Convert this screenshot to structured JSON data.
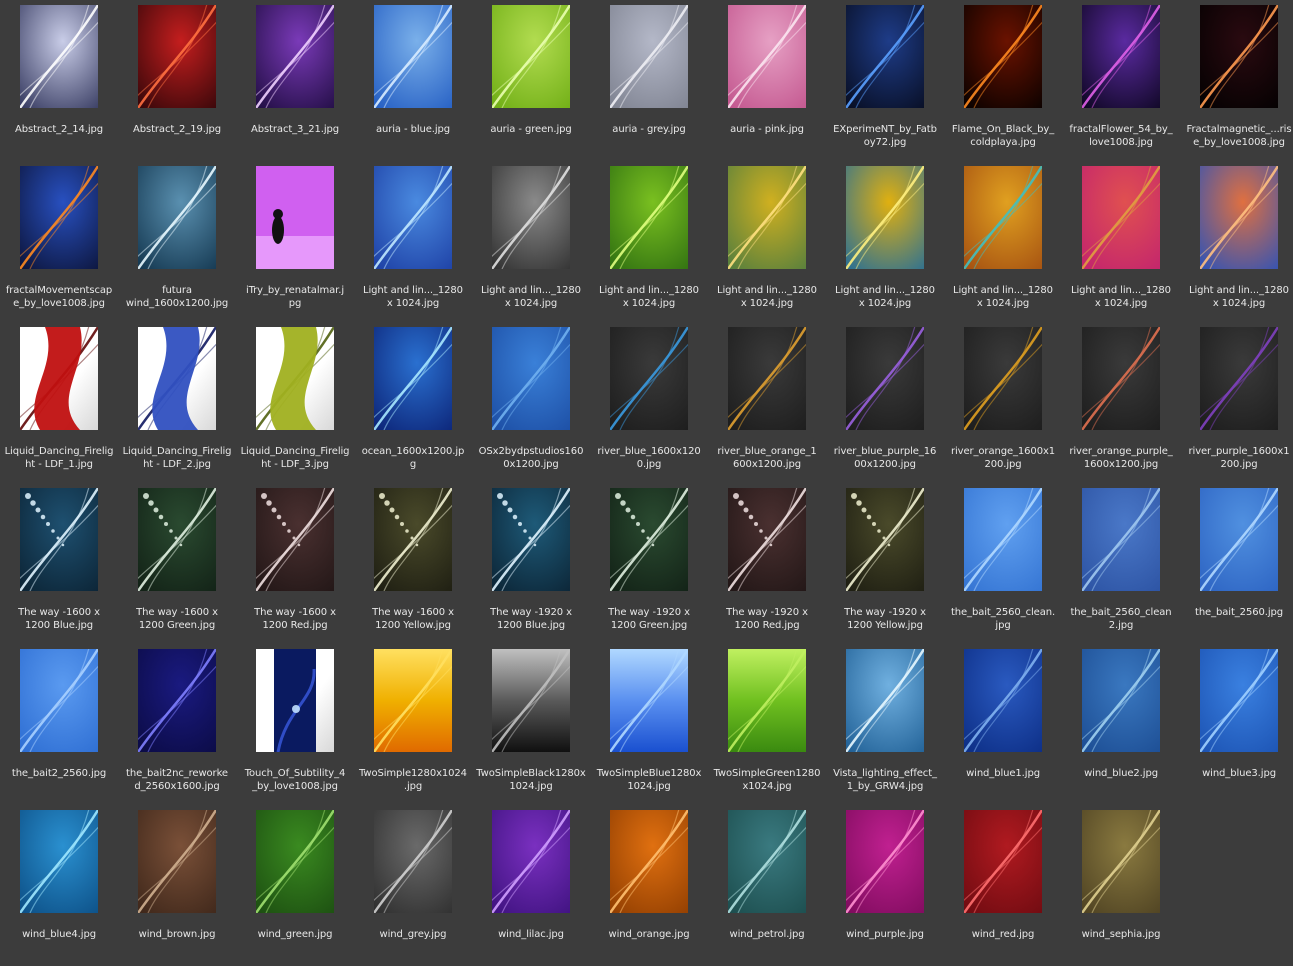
{
  "files": [
    {
      "label": "Abstract_2_14.jpg",
      "icon": "abstract-light-thumbnail",
      "colors": [
        "#2a2e55",
        "#c9cde8",
        "#ffffff"
      ]
    },
    {
      "label": "Abstract_2_19.jpg",
      "icon": "abstract-red-thumbnail",
      "colors": [
        "#2a0508",
        "#c41e1e",
        "#ff7040"
      ]
    },
    {
      "label": "Abstract_3_21.jpg",
      "icon": "abstract-purple-thumbnail",
      "colors": [
        "#1a0a3a",
        "#7a3ab8",
        "#f0d0ff"
      ]
    },
    {
      "label": "auria - blue.jpg",
      "icon": "auria-blue-thumbnail",
      "colors": [
        "#1e58c0",
        "#7ab0ea",
        "#d8ecff"
      ]
    },
    {
      "label": "auria - green.jpg",
      "icon": "auria-green-thumbnail",
      "colors": [
        "#6aaa10",
        "#b2dc50",
        "#eaffb0"
      ]
    },
    {
      "label": "auria - grey.jpg",
      "icon": "auria-grey-thumbnail",
      "colors": [
        "#7a7e8c",
        "#b4b8c8",
        "#eeeef4"
      ]
    },
    {
      "label": "auria - pink.jpg",
      "icon": "auria-pink-thumbnail",
      "colors": [
        "#c0508a",
        "#e6a0c4",
        "#fbe4f0"
      ]
    },
    {
      "label": "EXperimeNT_by_Fatb\noy72.jpg",
      "icon": "experiment-thumbnail",
      "colors": [
        "#060a1a",
        "#1e3c88",
        "#5aa0ff"
      ]
    },
    {
      "label": "Flame_On_Black_by_\ncoldplaya.jpg",
      "icon": "flame-thumbnail",
      "colors": [
        "#000000",
        "#6a1200",
        "#ff8a20"
      ]
    },
    {
      "label": "fractalFlower_54_by_\nlove1008.jpg",
      "icon": "fractal-flower-thumbnail",
      "colors": [
        "#080418",
        "#5a2aa0",
        "#e060e8"
      ]
    },
    {
      "label": "Fractalmagnetic_...ris\ne_by_love1008.jpg",
      "icon": "fractal-magnetic-thumbnail",
      "colors": [
        "#000000",
        "#2a0a10",
        "#ff9a50"
      ]
    },
    {
      "label": "fractalMovementscap\ne_by_love1008.jpg",
      "icon": "fractal-movement-thumbnail",
      "colors": [
        "#0a1030",
        "#2850c0",
        "#ff8a20"
      ]
    },
    {
      "label": "futura\nwind_1600x1200.jpg",
      "icon": "futura-wind-thumbnail",
      "colors": [
        "#0e3048",
        "#5a90b0",
        "#e8f8ff"
      ]
    },
    {
      "label": "iTry_by_renatalmar.j\npg",
      "icon": "itry-thumbnail",
      "colors": [
        "#8a1ec0",
        "#d060f0",
        "#f0b0ff"
      ]
    },
    {
      "label": "Light and lin..._1280\nx 1024.jpg",
      "icon": "light-lines-blue-thumbnail",
      "colors": [
        "#1a3aa0",
        "#4a8ae0",
        "#c0e8ff"
      ]
    },
    {
      "label": "Light and lin..._1280\nx 1024.jpg",
      "icon": "light-lines-grey-thumbnail",
      "colors": [
        "#2a2a2a",
        "#8a8a8a",
        "#e0e0e0"
      ]
    },
    {
      "label": "Light and lin..._1280\nx 1024.jpg",
      "icon": "light-lines-green-thumbnail",
      "colors": [
        "#2a6a10",
        "#7ac020",
        "#e0ff80"
      ]
    },
    {
      "label": "Light and lin..._1280\nx 1024.jpg",
      "icon": "light-lines-yellow-thumbnail",
      "colors": [
        "#4a7a40",
        "#d0b020",
        "#ffe080"
      ]
    },
    {
      "label": "Light and lin..._1280\nx 1024.jpg",
      "icon": "light-lines-gold-thumbnail",
      "colors": [
        "#1a6aa0",
        "#e0b010",
        "#fff080"
      ]
    },
    {
      "label": "Light and lin..._1280\nx 1024.jpg",
      "icon": "light-lines-teal-thumbnail",
      "colors": [
        "#a04a10",
        "#e0a020",
        "#40c0c0"
      ]
    },
    {
      "label": "Light and lin..._1280\nx 1024.jpg",
      "icon": "light-lines-magenta-thumbnail",
      "colors": [
        "#c02070",
        "#e05050",
        "#e0a040"
      ]
    },
    {
      "label": "Light and lin..._1280\nx 1024.jpg",
      "icon": "light-lines-sunset-thumbnail",
      "colors": [
        "#2050c0",
        "#e07040",
        "#ffc080"
      ]
    },
    {
      "label": "Liquid_Dancing_Firelig\nht - LDF_1.jpg",
      "icon": "liquid-red-thumbnail",
      "colors": [
        "#ffffff",
        "#c01010",
        "#600808"
      ]
    },
    {
      "label": "Liquid_Dancing_Firelig\nht - LDF_2.jpg",
      "icon": "liquid-blue-thumbnail",
      "colors": [
        "#ffffff",
        "#3050c0",
        "#101860"
      ]
    },
    {
      "label": "Liquid_Dancing_Firelig\nht - LDF_3.jpg",
      "icon": "liquid-green-thumbnail",
      "colors": [
        "#ffffff",
        "#a0b020",
        "#506010"
      ]
    },
    {
      "label": "ocean_1600x1200.jp\ng",
      "icon": "ocean-thumbnail",
      "colors": [
        "#0a1e70",
        "#2a70d0",
        "#a8e8ff"
      ]
    },
    {
      "label": "OSx2bydpstudios160\n0x1200.jpg",
      "icon": "osx-thumbnail",
      "colors": [
        "#1a4aa0",
        "#3a80d8",
        "#70b0f0"
      ]
    },
    {
      "label": "river_blue_1600x120\n0.jpg",
      "icon": "river-blue-thumbnail",
      "colors": [
        "#1a1a1a",
        "#3a3a3a",
        "#3a9ae0"
      ]
    },
    {
      "label": "river_blue_orange_1\n600x1200.jpg",
      "icon": "river-blue-orange-thumbnail",
      "colors": [
        "#1a1a1a",
        "#3a3a3a",
        "#e0a030"
      ]
    },
    {
      "label": "river_blue_purple_16\n00x1200.jpg",
      "icon": "river-blue-purple-thumbnail",
      "colors": [
        "#1a1a1a",
        "#3a3a3a",
        "#9a60e0"
      ]
    },
    {
      "label": "river_orange_1600x1\n200.jpg",
      "icon": "river-orange-thumbnail",
      "colors": [
        "#1a1a1a",
        "#3a3a3a",
        "#e0a020"
      ]
    },
    {
      "label": "river_orange_purple_\n1600x1200.jpg",
      "icon": "river-orange-purple-thumbnail",
      "colors": [
        "#1a1a1a",
        "#3a3a3a",
        "#e07050"
      ]
    },
    {
      "label": "river_purple_1600x1\n200.jpg",
      "icon": "river-purple-thumbnail",
      "colors": [
        "#1a1a1a",
        "#3a3a3a",
        "#8040c0"
      ]
    },
    {
      "label": "The way -1600 x\n1200 Blue.jpg",
      "icon": "the-way-blue-thumbnail",
      "colors": [
        "#0a2030",
        "#1e5070",
        "#e0f4ff"
      ]
    },
    {
      "label": "The way -1600 x\n1200 Green.jpg",
      "icon": "the-way-green-thumbnail",
      "colors": [
        "#101e14",
        "#2a4a30",
        "#e0f0e0"
      ]
    },
    {
      "label": "The way -1600 x\n1200 Red.jpg",
      "icon": "the-way-red-thumbnail",
      "colors": [
        "#1e1414",
        "#4a3030",
        "#f0e0e0"
      ]
    },
    {
      "label": "The way -1600 x\n1200 Yellow.jpg",
      "icon": "the-way-yellow-thumbnail",
      "colors": [
        "#1a1a10",
        "#4a4a2a",
        "#f0f0d0"
      ]
    },
    {
      "label": "The way -1920 x\n1200 Blue.jpg",
      "icon": "the-way-1920-blue-thumbnail",
      "colors": [
        "#0a2030",
        "#1e5a78",
        "#e0f4ff"
      ]
    },
    {
      "label": "The way -1920 x\n1200 Green.jpg",
      "icon": "the-way-1920-green-thumbnail",
      "colors": [
        "#101e14",
        "#2a4a30",
        "#e0f0e0"
      ]
    },
    {
      "label": "The way -1920 x\n1200 Red.jpg",
      "icon": "the-way-1920-red-thumbnail",
      "colors": [
        "#1e1414",
        "#4a3030",
        "#f0e0e0"
      ]
    },
    {
      "label": "The way -1920 x\n1200 Yellow.jpg",
      "icon": "the-way-1920-yellow-thumbnail",
      "colors": [
        "#1a1a10",
        "#4a4a2a",
        "#f0f0d0"
      ]
    },
    {
      "label": "the_bait_2560_clean.\njpg",
      "icon": "bait-clean-thumbnail",
      "colors": [
        "#3070d0",
        "#60a0f0",
        "#b0d8ff"
      ]
    },
    {
      "label": "the_bait_2560_clean\n2.jpg",
      "icon": "bait-clean2-thumbnail",
      "colors": [
        "#2a50a0",
        "#4a78c8",
        "#a0c8f0"
      ]
    },
    {
      "label": "the_bait_2560.jpg",
      "icon": "bait-thumbnail",
      "colors": [
        "#2a60c0",
        "#5090e0",
        "#b0d8ff"
      ]
    },
    {
      "label": "the_bait2_2560.jpg",
      "icon": "bait2-thumbnail",
      "colors": [
        "#2a6ad0",
        "#5a9af0",
        "#a8d0ff"
      ]
    },
    {
      "label": "the_bait2nc_reworke\nd_2560x1600.jpg",
      "icon": "bait2nc-thumbnail",
      "colors": [
        "#0a0a40",
        "#1a1a80",
        "#8080ff"
      ]
    },
    {
      "label": "Touch_Of_Subtility_4\n_by_love1008.jpg",
      "icon": "touch-subtility-thumbnail",
      "colors": [
        "#ffffff",
        "#0a1a60",
        "#3a5ae0"
      ]
    },
    {
      "label": "TwoSimple1280x1024\n.jpg",
      "icon": "twosimple-thumbnail",
      "colors": [
        "#e06a00",
        "#f0b000",
        "#ffe060"
      ]
    },
    {
      "label": "TwoSimpleBlack1280x\n1024.jpg",
      "icon": "twosimple-black-thumbnail",
      "colors": [
        "#101010",
        "#5a5a5a",
        "#c0c0c0"
      ]
    },
    {
      "label": "TwoSimpleBlue1280x\n1024.jpg",
      "icon": "twosimple-blue-thumbnail",
      "colors": [
        "#1a50d0",
        "#5a90f0",
        "#b0d8ff"
      ]
    },
    {
      "label": "TwoSimpleGreen1280\nx1024.jpg",
      "icon": "twosimple-green-thumbnail",
      "colors": [
        "#3a8a10",
        "#70c020",
        "#c0f060"
      ]
    },
    {
      "label": "Vista_lighting_effect_\n1_by_GRW4.jpg",
      "icon": "vista-lighting-thumbnail",
      "colors": [
        "#1a5a90",
        "#70b0e0",
        "#e8f8ff"
      ]
    },
    {
      "label": "wind_blue1.jpg",
      "icon": "wind-blue1-thumbnail",
      "colors": [
        "#0a2a80",
        "#2a5ac0",
        "#80b0f0"
      ]
    },
    {
      "label": "wind_blue2.jpg",
      "icon": "wind-blue2-thumbnail",
      "colors": [
        "#1a4a90",
        "#3a78c0",
        "#a0d0f0"
      ]
    },
    {
      "label": "wind_blue3.jpg",
      "icon": "wind-blue3-thumbnail",
      "colors": [
        "#1a50b0",
        "#3a80e0",
        "#a0d0ff"
      ]
    },
    {
      "label": "wind_blue4.jpg",
      "icon": "wind-blue4-thumbnail",
      "colors": [
        "#0a4a80",
        "#2a90d0",
        "#a0e8ff"
      ]
    },
    {
      "label": "wind_brown.jpg",
      "icon": "wind-brown-thumbnail",
      "colors": [
        "#3a2418",
        "#7a5038",
        "#d0b090"
      ]
    },
    {
      "label": "wind_green.jpg",
      "icon": "wind-green-thumbnail",
      "colors": [
        "#1a4a10",
        "#3a8a20",
        "#a0e070"
      ]
    },
    {
      "label": "wind_grey.jpg",
      "icon": "wind-grey-thumbnail",
      "colors": [
        "#2a2a2a",
        "#6a6a6a",
        "#d0d0d0"
      ]
    },
    {
      "label": "wind_lilac.jpg",
      "icon": "wind-lilac-thumbnail",
      "colors": [
        "#3a107a",
        "#7a30c0",
        "#d0a0ff"
      ]
    },
    {
      "label": "wind_orange.jpg",
      "icon": "wind-orange-thumbnail",
      "colors": [
        "#8a3a00",
        "#e07010",
        "#ffc070"
      ]
    },
    {
      "label": "wind_petrol.jpg",
      "icon": "wind-petrol-thumbnail",
      "colors": [
        "#1a4a4a",
        "#3a7a80",
        "#b0e0e0"
      ]
    },
    {
      "label": "wind_purple.jpg",
      "icon": "wind-purple-thumbnail",
      "colors": [
        "#7a0a5a",
        "#c02090",
        "#ff90d0"
      ]
    },
    {
      "label": "wind_red.jpg",
      "icon": "wind-red-thumbnail",
      "colors": [
        "#6a0a10",
        "#b01a20",
        "#ff7070"
      ]
    },
    {
      "label": "wind_sephia.jpg",
      "icon": "wind-sephia-thumbnail",
      "colors": [
        "#4a3e20",
        "#8a7a40",
        "#e0d090"
      ]
    }
  ]
}
